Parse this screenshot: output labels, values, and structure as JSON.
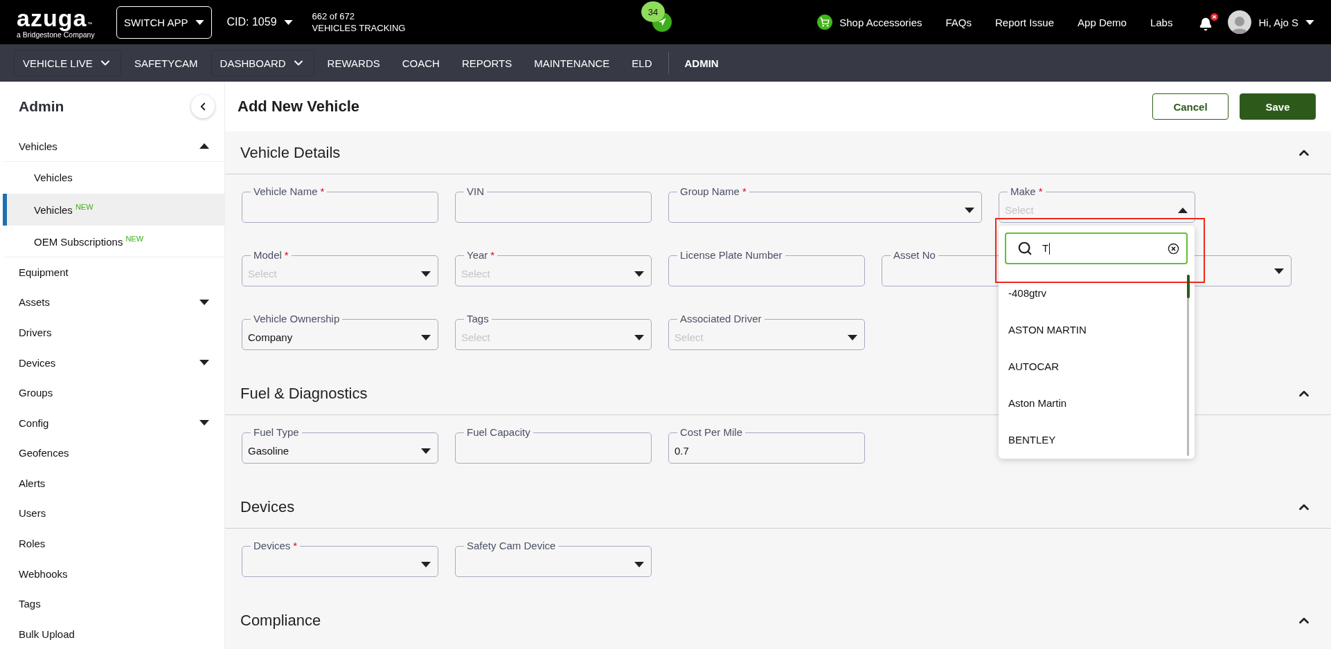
{
  "top_bar": {
    "logo": "azuga",
    "logo_mark": "™",
    "logo_tagline": "a Bridgestone Company",
    "switch_app": "SWITCH APP",
    "cid": "CID: 1059",
    "tracking": [
      "662 of 672",
      "VEHICLES TRACKING"
    ],
    "cluster_count": "34",
    "links": [
      {
        "label": "Shop Accessories",
        "kind": "shop"
      },
      {
        "label": "FAQs",
        "kind": "text"
      },
      {
        "label": "Report Issue",
        "kind": "text"
      },
      {
        "label": "App Demo",
        "kind": "text"
      },
      {
        "label": "Labs",
        "kind": "text"
      }
    ],
    "notifications": {
      "alert": true
    },
    "user": "Hi, Ajo S"
  },
  "nav": [
    {
      "label": "VEHICLE LIVE",
      "menu": true,
      "selected": false
    },
    {
      "label": "SAFETYCAM",
      "menu": false,
      "selected": false
    },
    {
      "label": "DASHBOARD",
      "menu": true,
      "selected": false
    },
    {
      "label": "REWARDS",
      "menu": false,
      "selected": false
    },
    {
      "label": "COACH",
      "menu": false,
      "selected": false
    },
    {
      "label": "REPORTS",
      "menu": false,
      "selected": false
    },
    {
      "label": "MAINTENANCE",
      "menu": false,
      "selected": false
    },
    {
      "label": "ELD",
      "menu": false,
      "selected": false
    },
    {
      "label": "ADMIN",
      "menu": false,
      "selected": true
    }
  ],
  "sidebar": {
    "title": "Admin",
    "items": [
      {
        "label": "Vehicles",
        "expanded": true,
        "selected": false,
        "children": [
          {
            "label": "Vehicles",
            "selected": false
          },
          {
            "label": "Vehicles",
            "badge": "NEW",
            "selected": true
          },
          {
            "label": "OEM Subscriptions",
            "badge": "NEW",
            "selected": false
          }
        ]
      },
      {
        "label": "Equipment",
        "selected": false
      },
      {
        "label": "Assets",
        "expanded": false,
        "selected": false
      },
      {
        "label": "Drivers",
        "selected": false
      },
      {
        "label": "Devices",
        "expanded": false,
        "selected": false
      },
      {
        "label": "Groups",
        "selected": false
      },
      {
        "label": "Config",
        "expanded": false,
        "selected": false
      },
      {
        "label": "Geofences",
        "selected": false
      },
      {
        "label": "Alerts",
        "selected": false
      },
      {
        "label": "Users",
        "selected": false
      },
      {
        "label": "Roles",
        "selected": false
      },
      {
        "label": "Webhooks",
        "selected": false
      },
      {
        "label": "Tags",
        "selected": false
      },
      {
        "label": "Bulk Upload",
        "selected": false
      }
    ]
  },
  "page": {
    "title": "Add New Vehicle",
    "buttons": [
      {
        "label": "Cancel",
        "kind": "secondary"
      },
      {
        "label": "Save",
        "kind": "primary"
      }
    ]
  },
  "sections": [
    {
      "title": "Vehicle Details",
      "expanded": true,
      "rows": [
        [
          {
            "label": "Vehicle Name",
            "required_mark": "*",
            "kind": "text"
          },
          {
            "label": "VIN",
            "kind": "text"
          },
          {
            "label": "Group Name",
            "required_mark": "*",
            "kind": "select",
            "open": false
          },
          {
            "label": "Make",
            "required_mark": "*",
            "kind": "select",
            "open": true,
            "placeholder": "Select",
            "menu": {
              "search": "T",
              "highlighted": true,
              "options": [
                "-408gtrv",
                "ASTON MARTIN",
                "AUTOCAR",
                "Aston Martin",
                "BENTLEY"
              ]
            }
          }
        ],
        [
          {
            "label": "Model",
            "required_mark": "*",
            "kind": "select",
            "open": false,
            "placeholder": "Select"
          },
          {
            "label": "Year",
            "required_mark": "*",
            "kind": "select",
            "open": false,
            "placeholder": "Select"
          },
          {
            "label": "License Plate Number",
            "kind": "text"
          },
          {
            "label": "Asset No",
            "kind": "text"
          },
          {
            "kind": "select",
            "open": false
          }
        ],
        [
          {
            "label": "Vehicle Ownership",
            "kind": "select",
            "open": false,
            "value": "Company"
          },
          {
            "label": "Tags",
            "kind": "select",
            "open": false,
            "placeholder": "Select"
          },
          {
            "label": "Associated Driver",
            "kind": "select",
            "open": false,
            "placeholder": "Select"
          }
        ]
      ]
    },
    {
      "title": "Fuel & Diagnostics",
      "expanded": true,
      "rows": [
        [
          {
            "label": "Fuel Type",
            "kind": "select",
            "open": false,
            "value": "Gasoline"
          },
          {
            "label": "Fuel Capacity",
            "kind": "text"
          },
          {
            "label": "Cost Per Mile",
            "kind": "text",
            "value": "0.7"
          }
        ]
      ]
    },
    {
      "title": "Devices",
      "expanded": true,
      "rows": [
        [
          {
            "label": "Devices",
            "required_mark": "*",
            "kind": "select",
            "open": false
          },
          {
            "label": "Safety Cam Device",
            "kind": "select",
            "open": false
          }
        ]
      ]
    },
    {
      "title": "Compliance",
      "expanded": true
    }
  ]
}
